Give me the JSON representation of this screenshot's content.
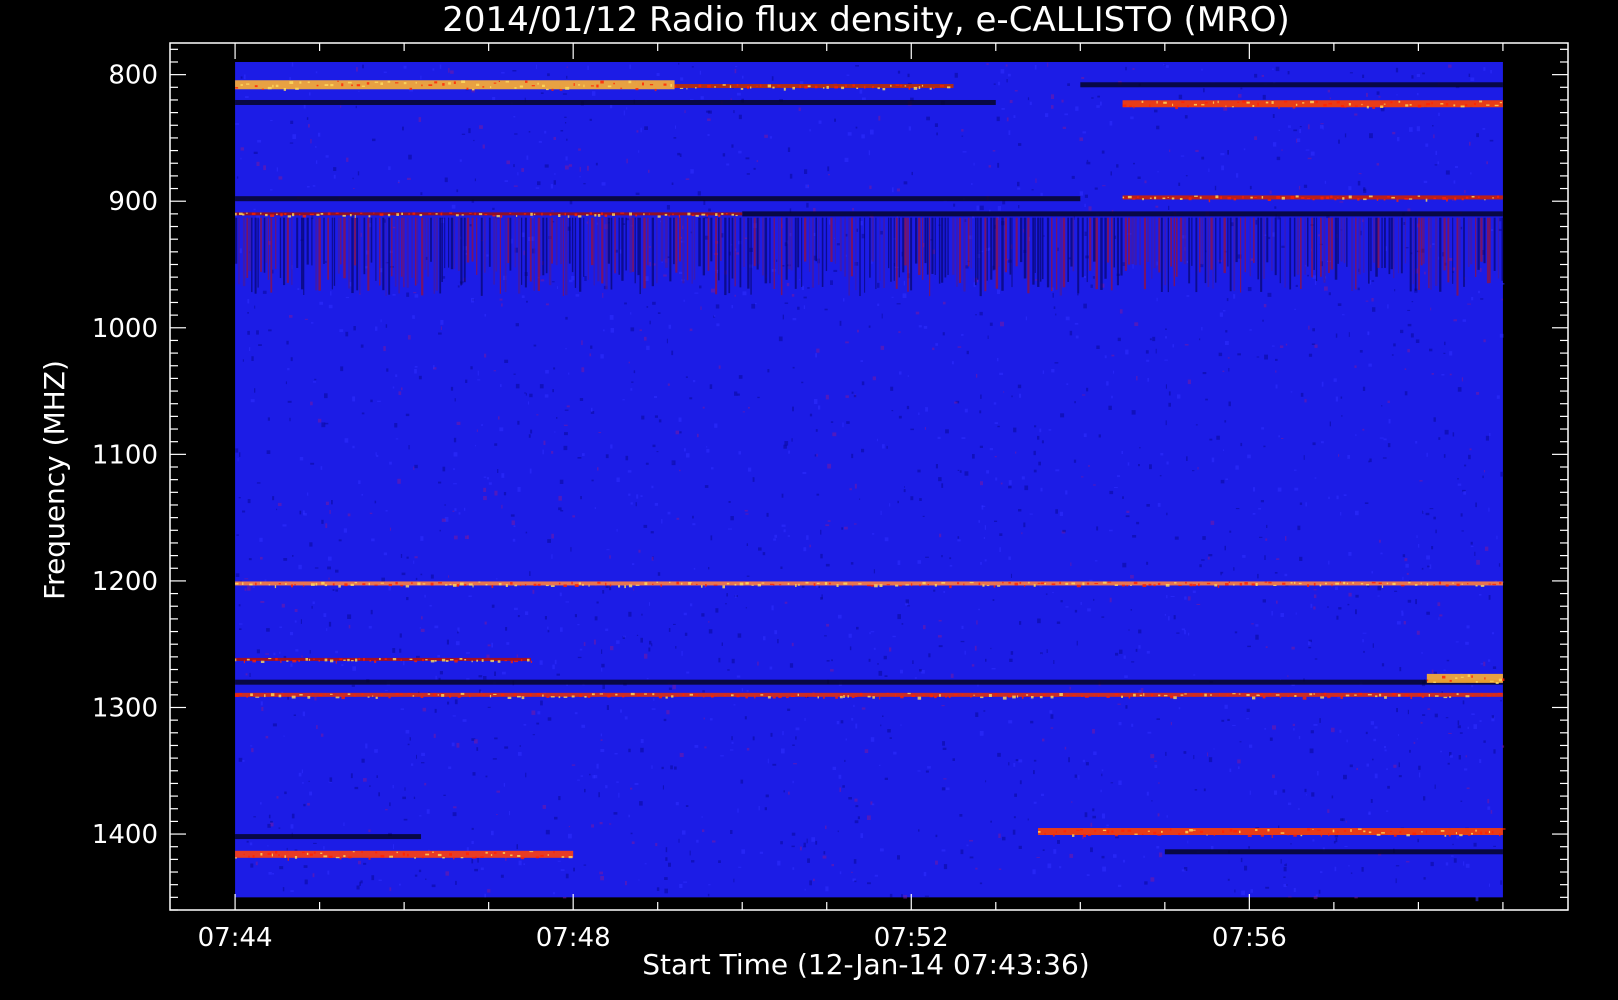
{
  "chart_data": {
    "type": "heatmap",
    "title": "2014/01/12  Radio flux density, e-CALLISTO (MRO)",
    "xlabel": "Start Time (12-Jan-14 07:43:36)",
    "ylabel": "Frequency (MHZ)",
    "x_tick_labels": [
      "07:44",
      "07:48",
      "07:52",
      "07:56"
    ],
    "x_ticks_minutes": [
      0,
      4,
      8,
      12
    ],
    "x_range_minutes": [
      -0.77,
      15.77
    ],
    "data_start_minutes": 0,
    "data_end_minutes": 15,
    "y_tick_labels": [
      "800",
      "900",
      "1000",
      "1100",
      "1200",
      "1300",
      "1400"
    ],
    "y_ticks": [
      800,
      900,
      1000,
      1100,
      1200,
      1300,
      1400
    ],
    "ylim": [
      1460,
      775
    ],
    "data_freq_range": [
      790,
      1450
    ],
    "y_minor_step": 10,
    "x_minor_step_minutes": 1,
    "background_color": "#1c1ce6",
    "colormap": [
      "#000020",
      "#1a1ae8",
      "#c00000",
      "#ff3000",
      "#ffd040"
    ],
    "features": [
      {
        "label": "808 MHz",
        "freq": 808,
        "t_start": 0,
        "t_end": 5.2,
        "intensity": "very-high",
        "color": "#ffb030"
      },
      {
        "label": "808 MHz tail",
        "freq": 809,
        "t_start": 5.2,
        "t_end": 8.5,
        "intensity": "medium",
        "color": "#c03000"
      },
      {
        "label": "823 MHz",
        "freq": 823,
        "t_start": 10.5,
        "t_end": 15,
        "intensity": "high",
        "color": "#ff4000"
      },
      {
        "label": "897 MHz",
        "freq": 897,
        "t_start": 10.5,
        "t_end": 15,
        "intensity": "medium",
        "color": "#d02000"
      },
      {
        "label": "910 MHz",
        "freq": 910,
        "t_start": 0,
        "t_end": 6,
        "intensity": "low",
        "color": "#a01010"
      },
      {
        "label": "1200 MHz",
        "freq": 1202,
        "t_start": 0,
        "t_end": 15,
        "intensity": "medium",
        "color": "#ff8040"
      },
      {
        "label": "1262 MHz",
        "freq": 1262,
        "t_start": 0,
        "t_end": 3.5,
        "intensity": "low",
        "color": "#b01010"
      },
      {
        "label": "1277 MHz",
        "freq": 1277,
        "t_start": 14.1,
        "t_end": 15,
        "intensity": "very-high",
        "color": "#ffb030"
      },
      {
        "label": "1290 MHz",
        "freq": 1290,
        "t_start": 0,
        "t_end": 15,
        "intensity": "medium",
        "color": "#e03010"
      },
      {
        "label": "1398 MHz",
        "freq": 1398,
        "t_start": 9.5,
        "t_end": 15,
        "intensity": "high",
        "color": "#ff4000"
      },
      {
        "label": "1416 MHz",
        "freq": 1416,
        "t_start": 0,
        "t_end": 4,
        "intensity": "high",
        "color": "#ff4010"
      }
    ],
    "dark_bands": [
      {
        "freq": 822,
        "t_start": 0,
        "t_end": 9
      },
      {
        "freq": 808,
        "t_start": 10,
        "t_end": 15
      },
      {
        "freq": 898,
        "t_start": 0,
        "t_end": 10
      },
      {
        "freq": 910,
        "t_start": 6,
        "t_end": 15
      },
      {
        "freq": 1280,
        "t_start": 0,
        "t_end": 15
      },
      {
        "freq": 1402,
        "t_start": 0,
        "t_end": 2.2
      },
      {
        "freq": 1414,
        "t_start": 11,
        "t_end": 15
      }
    ],
    "vertical_streak_band": [
      913,
      975
    ]
  }
}
